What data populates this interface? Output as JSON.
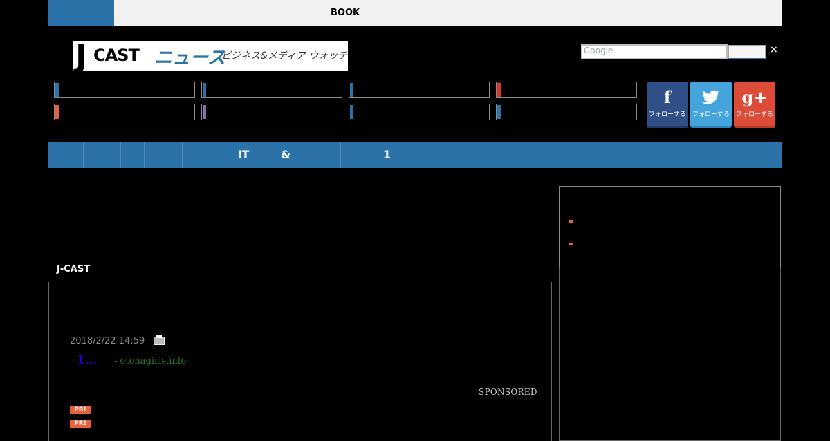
{
  "topbar": {
    "book_label": "BOOK"
  },
  "logo": {
    "j": "J",
    "cast": "CAST",
    "news": "ニュース",
    "tagline": "ビジネス&メディア ウォッチ"
  },
  "search": {
    "placeholder": "Google",
    "clear_label": "×"
  },
  "categories": {
    "colors": [
      "#2a72a8",
      "#2a72a8",
      "#2a72a8",
      "#d9352b",
      "#e8603c",
      "#8e6bb5",
      "#2a72a8",
      "#2a72a8"
    ]
  },
  "social": [
    {
      "icon": "f",
      "label": "フォローする",
      "color": "#2f4f86"
    },
    {
      "icon": "t",
      "label": "フォローする",
      "color": "#45a4dc"
    },
    {
      "icon": "g+",
      "label": "フォローする",
      "color": "#dd4b39"
    }
  ],
  "nav": {
    "items": [
      "",
      "",
      "",
      "",
      "",
      "IT",
      "&",
      "",
      "1"
    ]
  },
  "main": {
    "section_label": "J-CAST",
    "date": "2018/2/22 14:59",
    "ad_title": "1...",
    "ad_source": "- otonagirls.info",
    "sponsored": "SPONSORED",
    "pr_label": "PR!"
  }
}
